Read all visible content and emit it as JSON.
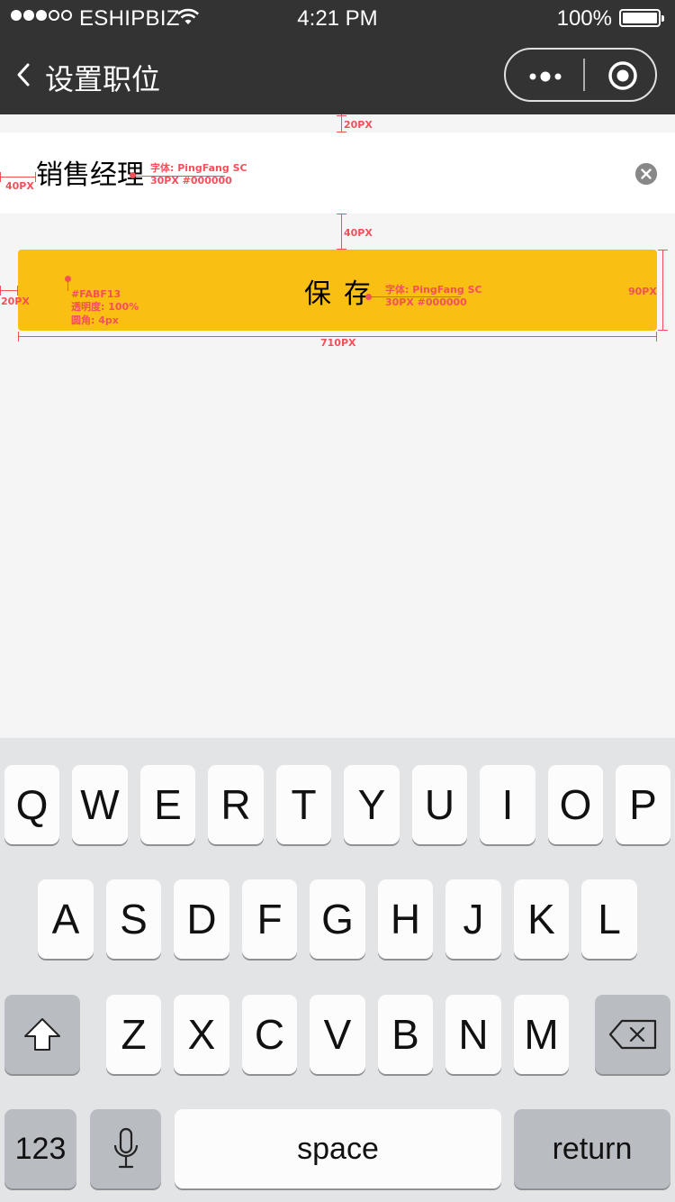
{
  "status_bar": {
    "carrier": "ESHIPBIZ",
    "time": "4:21 PM",
    "battery": "100%",
    "signal_bars_filled": 3,
    "signal_bars_total": 5
  },
  "nav": {
    "title": "设置职位",
    "back_icon": "chevron-left-icon",
    "more_icon": "more-dots-icon",
    "close_icon": "target-circle-icon"
  },
  "input": {
    "value": "销售经理",
    "clear_icon": "clear-circle-x-icon"
  },
  "save_button": {
    "label": "保存",
    "color": "#FABF13"
  },
  "annotations": {
    "top_gap": "20PX",
    "input_left": "40PX",
    "input_font_1": "字体: PingFang SC",
    "input_font_2": "30PX #000000",
    "mid_gap": "40PX",
    "btn_left": "20PX",
    "btn_color": "#FABF13",
    "btn_opacity": "透明度: 100%",
    "btn_radius": "圆角: 4px",
    "btn_font_1": "字体: PingFang SC",
    "btn_font_2": "30PX #000000",
    "btn_height": "90PX",
    "btn_width": "710PX"
  },
  "keyboard": {
    "row1": [
      "Q",
      "W",
      "E",
      "R",
      "T",
      "Y",
      "U",
      "I",
      "O",
      "P"
    ],
    "row2": [
      "A",
      "S",
      "D",
      "F",
      "G",
      "H",
      "J",
      "K",
      "L"
    ],
    "row3": [
      "Z",
      "X",
      "C",
      "V",
      "B",
      "N",
      "M"
    ],
    "shift_icon": "shift-arrow-icon",
    "delete_icon": "backspace-icon",
    "numbers": "123",
    "mic_icon": "microphone-icon",
    "space": "space",
    "return": "return"
  },
  "colors": {
    "header_bg": "#333333",
    "accent": "#FABF13",
    "annotation": "#f3505a",
    "page_bg": "#f5f5f5"
  }
}
